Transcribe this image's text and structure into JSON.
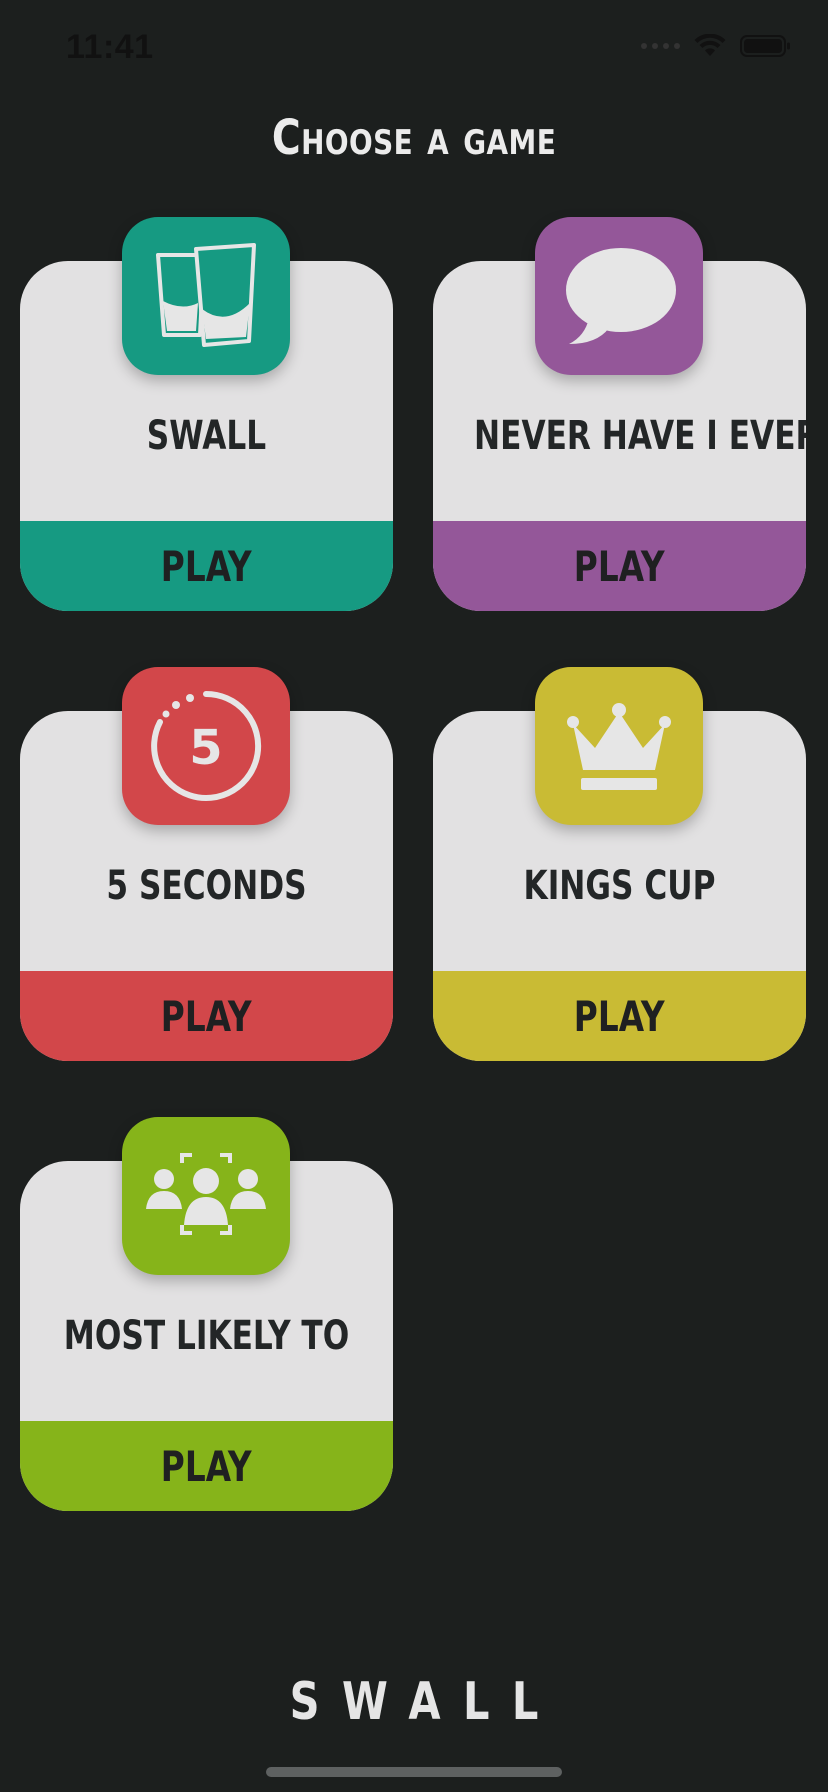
{
  "status_bar": {
    "time": "11:41"
  },
  "title": "Choose a game",
  "games": [
    {
      "name": "SWALL",
      "play_label": "PLAY",
      "color": "#169a82",
      "icon": "shot-glasses-icon"
    },
    {
      "name": "NEVER HAVE I EVER",
      "play_label": "PLAY",
      "color": "#945799",
      "icon": "speech-bubble-icon"
    },
    {
      "name": "5 SECONDS",
      "play_label": "PLAY",
      "color": "#d2474a",
      "icon": "timer-icon",
      "icon_text": "5"
    },
    {
      "name": "KINGS CUP",
      "play_label": "PLAY",
      "color": "#c9bb34",
      "icon": "crown-icon"
    },
    {
      "name": "MOST LIKELY TO",
      "play_label": "PLAY",
      "color": "#86b41a",
      "icon": "group-focus-icon"
    }
  ],
  "brand": "SWALL"
}
